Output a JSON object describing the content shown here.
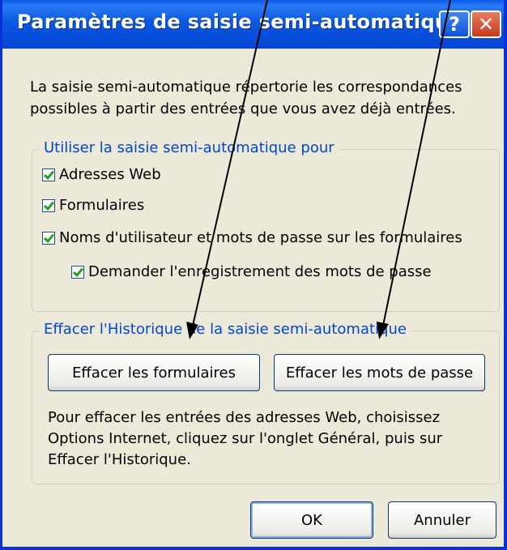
{
  "window": {
    "title": "Paramètres de saisie semi-automatique",
    "help_label": "?",
    "close_label": "✕"
  },
  "description": "La saisie semi-automatique répertorie les correspondances possibles à partir des entrées que vous avez déjà entrées.",
  "use_group": {
    "legend": "Utiliser la saisie semi-automatique pour",
    "options": [
      {
        "label": "Adresses Web",
        "checked": true
      },
      {
        "label": "Formulaires",
        "checked": true
      },
      {
        "label": "Noms d'utilisateur et mots de passe sur les formulaires",
        "checked": true
      },
      {
        "label": "Demander l'enregistrement des mots de passe",
        "checked": true
      }
    ]
  },
  "clear_group": {
    "legend": "Effacer l'Historique de la saisie semi-automatique",
    "clear_forms_label": "Effacer les formulaires",
    "clear_passwords_label": "Effacer les mots de passe",
    "info_text": "Pour effacer les entrées des adresses Web, choisissez Options Internet, cliquez sur l'onglet Général, puis sur Effacer l'Historique."
  },
  "buttons": {
    "ok_label": "OK",
    "cancel_label": "Annuler"
  },
  "colors": {
    "titlebar": "#0a5ce8",
    "dialog_bg": "#ece9d8",
    "legend_text": "#0046d5",
    "checkmark": "#21a121"
  }
}
